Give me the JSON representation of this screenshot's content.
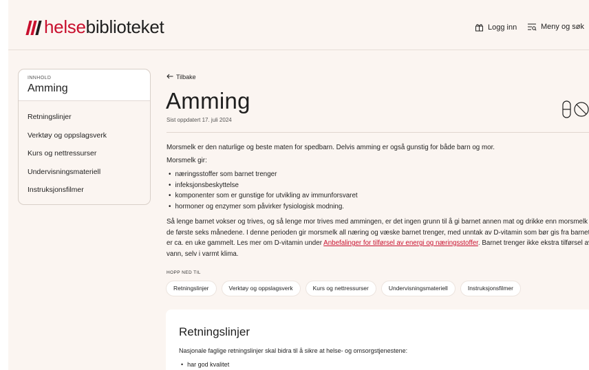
{
  "header": {
    "logo_part1": "helse",
    "logo_part2": "biblioteket",
    "login_label": "Logg inn",
    "menu_label": "Meny og søk"
  },
  "sidebar": {
    "kicker": "INNHOLD",
    "title": "Amming",
    "items": [
      {
        "label": "Retningslinjer"
      },
      {
        "label": "Verktøy og oppslagsverk"
      },
      {
        "label": "Kurs og nettressurser"
      },
      {
        "label": "Undervisningsmateriell"
      },
      {
        "label": "Instruksjonsfilmer"
      }
    ]
  },
  "main": {
    "back_label": "Tilbake",
    "title": "Amming",
    "updated": "Sist oppdatert 17. juli 2024",
    "intro": "Morsmelk er den naturlige og beste maten for spedbarn. Delvis amming er også gunstig for både barn og mor.",
    "gives_label": "Morsmelk gir:",
    "bullets": [
      "næringsstoffer som barnet trenger",
      "infeksjonsbeskyttelse",
      "komponenter som er gunstige for utvikling av immunforsvaret",
      "hormoner og enzymer som påvirker fysiologisk modning."
    ],
    "para_start": "Så lenge barnet vokser og trives, og så lenge mor trives med ammingen, er det ingen grunn til å gi barnet annen mat og drikke enn morsmelk de første seks månedene. I denne perioden gir morsmelk all næring og væske barnet trenger, med unntak av D-vitamin som bør gis fra barnet er ca. en uke gammelt. Les mer om D-vitamin under ",
    "para_link": "Anbefalinger for tilførsel av energi og næringsstoffer",
    "para_end": ". Barnet trenger ikke ekstra tilførsel av vann, selv i varmt klima.",
    "jump_label": "HOPP NED TIL",
    "chips": [
      {
        "label": "Retningslinjer"
      },
      {
        "label": "Verktøy og oppslagsverk"
      },
      {
        "label": "Kurs og nettressurser"
      },
      {
        "label": "Undervisningsmateriell"
      },
      {
        "label": "Instruksjonsfilmer"
      }
    ]
  },
  "section": {
    "title": "Retningslinjer",
    "text": "Nasjonale faglige retningslinjer skal bidra til å sikre at helse- og omsorgstjenestene:",
    "first_bullet": "har god kvalitet"
  },
  "colors": {
    "brand_red": "#c8102e",
    "background": "#fbf5f1"
  },
  "icons": [
    "gift-icon",
    "menu-search-icon",
    "arrow-left-icon",
    "pill-icon"
  ]
}
